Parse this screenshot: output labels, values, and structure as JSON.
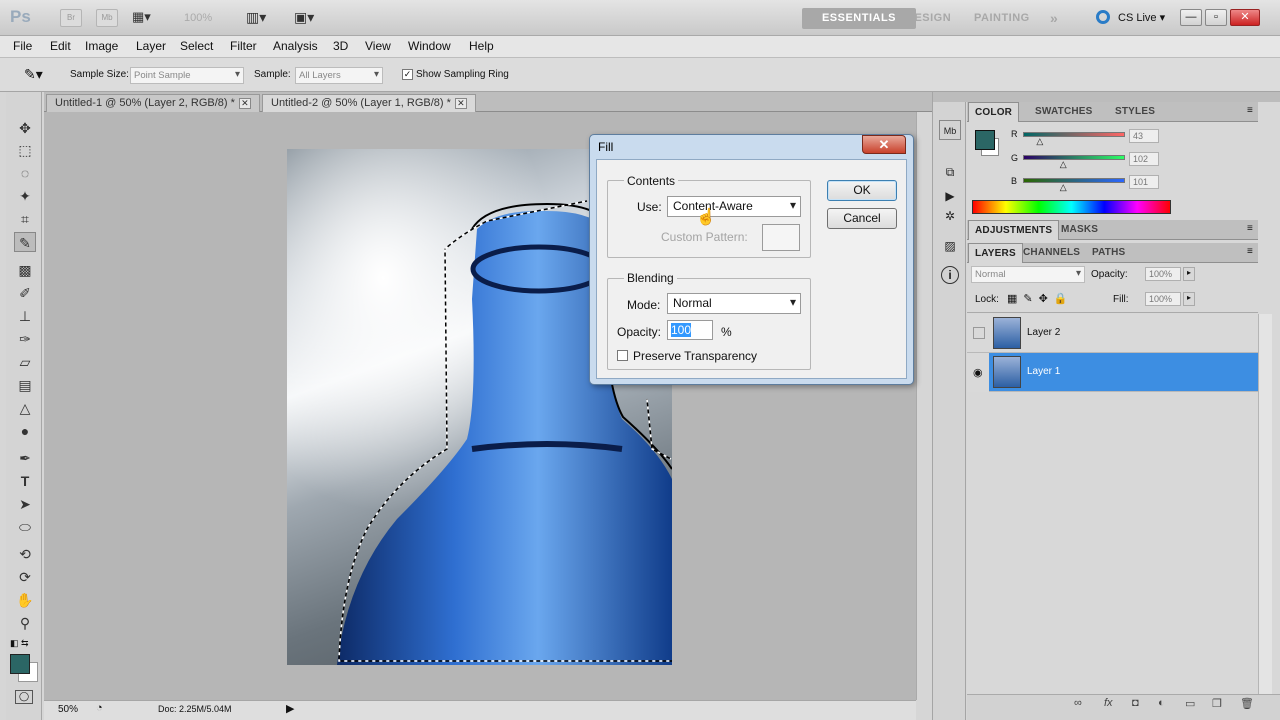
{
  "app": {
    "logo": "Ps",
    "bar_buttons": [
      "Br",
      "Mb"
    ],
    "zoom_display": "100%",
    "workspaces": [
      "ESSENTIALS",
      "DESIGN",
      "PAINTING"
    ],
    "workspace_more": "»",
    "cs_live": "CS Live",
    "window_controls": [
      "—",
      "▫",
      "✕"
    ]
  },
  "menu": [
    "File",
    "Edit",
    "Image",
    "Layer",
    "Select",
    "Filter",
    "Analysis",
    "3D",
    "View",
    "Window",
    "Help"
  ],
  "options": {
    "sample_size_label": "Sample Size:",
    "sample_size_value": "Point Sample",
    "sample_label": "Sample:",
    "sample_value": "All Layers",
    "show_ring_label": "Show Sampling Ring"
  },
  "tabs": [
    {
      "label": "Untitled-1 @ 50% (Layer 2, RGB/8) *",
      "close": "✕"
    },
    {
      "label": "Untitled-2 @ 50% (Layer 1, RGB/8) *",
      "close": "✕"
    }
  ],
  "status": {
    "zoom": "50%",
    "doc": "Doc: 2.25M/5.04M"
  },
  "fill_dialog": {
    "title": "Fill",
    "close": "✕",
    "contents_legend": "Contents",
    "use_label": "Use:",
    "use_value": "Content-Aware",
    "custom_pattern_label": "Custom Pattern:",
    "blending_legend": "Blending",
    "mode_label": "Mode:",
    "mode_value": "Normal",
    "opacity_label": "Opacity:",
    "opacity_value": "100",
    "opacity_unit": "%",
    "preserve_label": "Preserve Transparency",
    "ok": "OK",
    "cancel": "Cancel"
  },
  "color_panel": {
    "tabs": [
      "COLOR",
      "SWATCHES",
      "STYLES"
    ],
    "channels": [
      {
        "label": "R",
        "value": "43",
        "fraction": 0.17
      },
      {
        "label": "G",
        "value": "102",
        "fraction": 0.4
      },
      {
        "label": "B",
        "value": "101",
        "fraction": 0.4
      }
    ],
    "foreground": "#2b6665"
  },
  "adjust_tabs": [
    "ADJUSTMENTS",
    "MASKS"
  ],
  "layers_panel": {
    "tabs": [
      "LAYERS",
      "CHANNELS",
      "PATHS"
    ],
    "blend_mode": "Normal",
    "opacity_label": "Opacity:",
    "opacity_value": "100%",
    "lock_label": "Lock:",
    "fill_label": "Fill:",
    "fill_value": "100%",
    "layers": [
      {
        "name": "Layer 2",
        "selected": false,
        "visible": false
      },
      {
        "name": "Layer 1",
        "selected": true,
        "visible": true
      }
    ],
    "bottom_icons": [
      "∞",
      "fx",
      "◘",
      "◐",
      "▭",
      "❐",
      "🗑"
    ]
  }
}
